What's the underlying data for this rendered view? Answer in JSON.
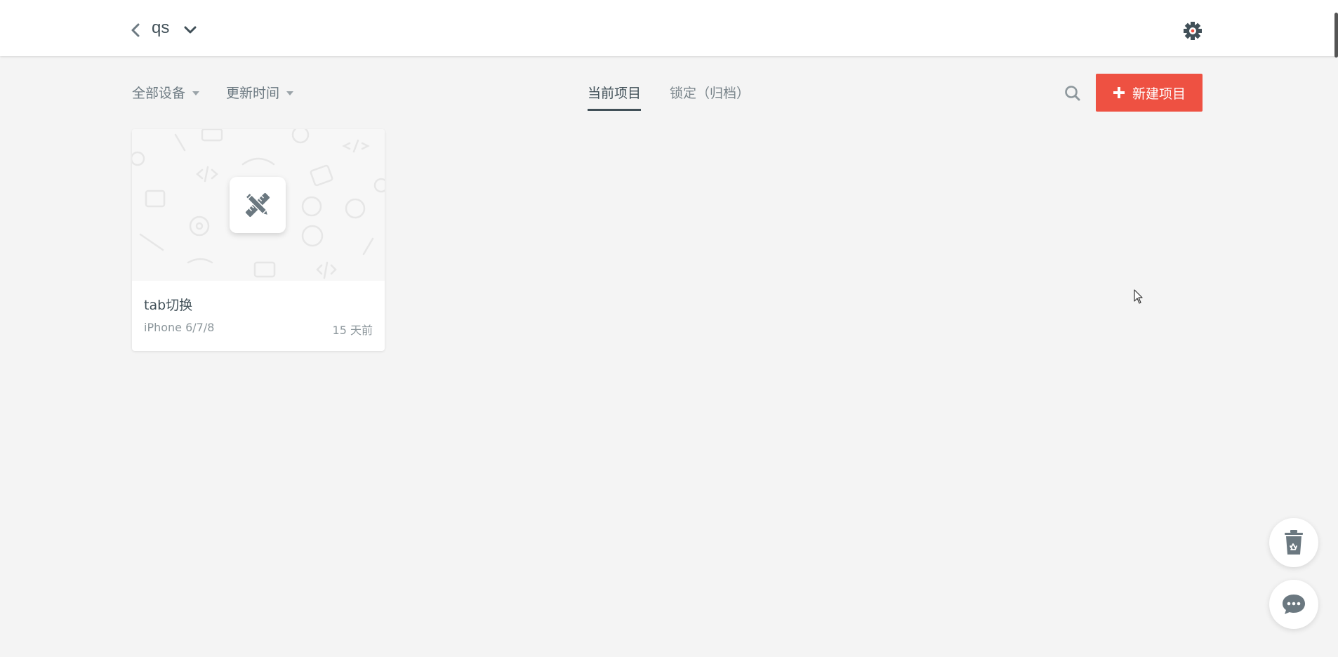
{
  "header": {
    "team_name": "qs"
  },
  "toolbar": {
    "filters": [
      {
        "label": "全部设备"
      },
      {
        "label": "更新时间"
      }
    ],
    "tabs": [
      {
        "label": "当前项目",
        "active": true
      },
      {
        "label": "锁定（归档）",
        "active": false
      }
    ],
    "new_project_label": "新建项目"
  },
  "projects": [
    {
      "title": "tab切换",
      "device": "iPhone 6/7/8",
      "updated": "15 天前"
    }
  ],
  "colors": {
    "accent": "#ee5142",
    "text": "#415058",
    "background": "#f4f4f4"
  },
  "icons": {
    "back": "chevron-left-icon",
    "team_dropdown": "chevron-down-icon",
    "settings": "gear-icon",
    "search": "search-icon",
    "new_project": "plus-icon",
    "project_placeholder": "pencil-ruler-icon",
    "trash": "recycle-bin-icon",
    "chat": "chat-bubble-icon"
  }
}
